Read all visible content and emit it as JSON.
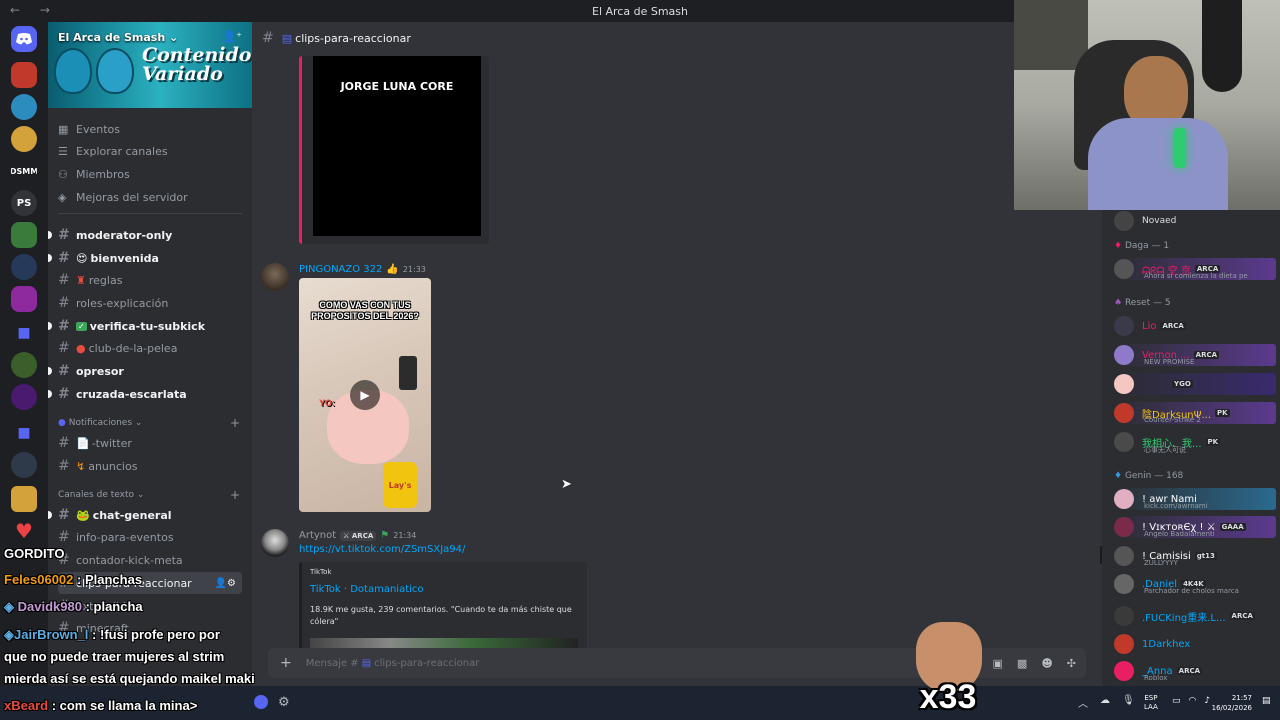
{
  "window": {
    "title": "El Arca de Smash"
  },
  "rail": {
    "discord_icon": "discord-logo-icon",
    "labels": [
      "DSMM",
      "PS"
    ]
  },
  "server": {
    "name": "El Arca de Smash",
    "banner_title": "Contenido Variado",
    "nav": [
      "Eventos",
      "Explorar canales",
      "Miembros",
      "Mejoras del servidor"
    ],
    "channels_top": [
      "moderator-only",
      "bienvenida",
      "reglas",
      "roles-explicación",
      "verifica-tu-subkick",
      "club-de-la-pelea",
      "opresor",
      "cruzada-escarlata"
    ],
    "category_notifications": "Notificaciones",
    "notif_channels": [
      "-twitter",
      "anuncios"
    ],
    "category_text": "Canales de texto",
    "text_channels": [
      "chat-general",
      "info-para-eventos",
      "contador-kick-meta",
      "clips-para-reaccionar",
      "extensible",
      "minecraft"
    ]
  },
  "channel": {
    "name": "clips-para-reaccionar",
    "composer_placeholder": "Mensaje #",
    "composer_channel": "clips-para-reaccionar"
  },
  "messages": [
    {
      "video_text": "JORGE LUNA CORE"
    },
    {
      "author": "PINGONAZO 322",
      "time": "21:33",
      "thumb_caption": "COMO VAS CON TUS PROPOSITOS DEL 2026?",
      "thumb_label": "YO:",
      "chips_label": "Lay's",
      "author_color": "#00a8fc"
    },
    {
      "author": "Artynot",
      "badge": "ARCA",
      "time": "21:34",
      "link": "https://vt.tiktok.com/ZSmSXJa94/",
      "embed": {
        "provider": "TikTok",
        "title": "TikTok · Dotamaniatico",
        "desc": "18.9K me gusta, 239 comentarios. \"Cuando te da más chiste que cólera\""
      }
    }
  ],
  "members": {
    "top_name": "Novaed",
    "groups": [
      {
        "label": "Daga — 1"
      },
      {
        "label": "Reset — 5"
      },
      {
        "label": "Genin — 168"
      }
    ],
    "daga": [
      {
        "name": "ᗩᖇᗩ 空 京",
        "tag": "ARCA",
        "sub": "Ahora si comienza la dieta pe"
      }
    ],
    "reset": [
      {
        "name": "Lio",
        "tag": "ARCA",
        "color": "#e91e63"
      },
      {
        "name": "Vernon ...",
        "tag": "ARCA",
        "sub": "NEW PROMISE",
        "color": "#e91e63"
      },
      {
        "name": "",
        "tag": "YGO",
        "color": "#e91e63"
      },
      {
        "name": "陰DarksunΨ...",
        "tag": "PK",
        "sub": "Counter-Strike 2",
        "color": "#f1c40f"
      },
      {
        "name": "我相心、我...",
        "tag": "PK",
        "sub": "心事无人可说",
        "color": "#2ecc71"
      }
    ],
    "genin": [
      {
        "name": "! awr Nami",
        "sub": "kick.com/awrnami"
      },
      {
        "name": "! VɪᴋᴛᴏʀЄχ ! ⚔",
        "tag": "GAAA",
        "sub": "Angelo Badalamenti"
      },
      {
        "name": "! Camisisi",
        "tag": "gt13",
        "sub": "ZULLYYYY"
      },
      {
        "name": ".Daniel",
        "tag": "4K4K",
        "sub": "Parchador de cholos marca"
      },
      {
        "name": ".FUCKing重来.L...",
        "tag": "ARCA"
      },
      {
        "name": "1Darkhex"
      },
      {
        "name": "_Anna",
        "tag": "ARCA",
        "sub": "Roblox"
      }
    ]
  },
  "overlay": {
    "header": "GORDITO",
    "lines": [
      {
        "user": "Feles06002",
        "text": "Planchas"
      },
      {
        "user": "Davidk980",
        "text": "plancha"
      },
      {
        "user": "JairBrown_l",
        "text": "!fusi profe pero por"
      },
      {
        "user": "",
        "text": "que no puede traer mujeres al strim"
      },
      {
        "user": "",
        "text": "mierda así se está quejando maikel maki"
      },
      {
        "user": "xBeard",
        "text": "com se llama la mina>"
      }
    ],
    "multiplier": "x33"
  },
  "taskbar": {
    "lang": "ESP",
    "lang2": "LAA",
    "time": "21:57",
    "date": "16/02/2026"
  },
  "colors": {
    "accent": "#5865f2",
    "pink_bar": "#e91e63",
    "link": "#00a8fc"
  }
}
